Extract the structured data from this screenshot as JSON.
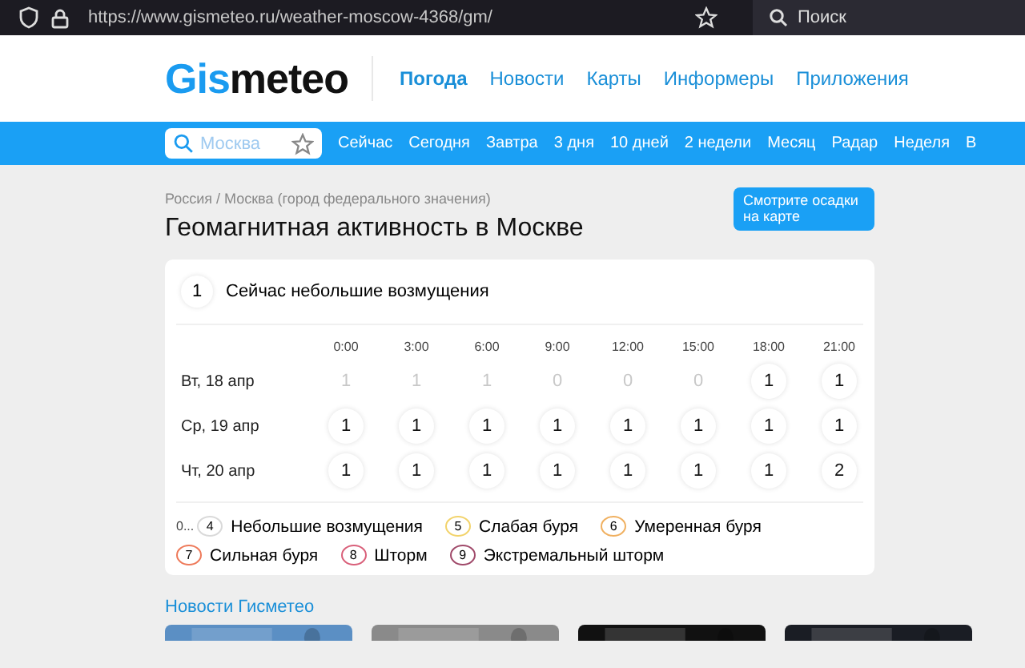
{
  "browser": {
    "url": "https://www.gismeteo.ru/weather-moscow-4368/gm/",
    "search_placeholder": "Поиск"
  },
  "logo": {
    "accent": "Gis",
    "rest": "meteo"
  },
  "main_menu": [
    {
      "label": "Погода",
      "selected": true
    },
    {
      "label": "Новости",
      "selected": false
    },
    {
      "label": "Карты",
      "selected": false
    },
    {
      "label": "Информеры",
      "selected": false
    },
    {
      "label": "Приложения",
      "selected": false
    }
  ],
  "city_search": {
    "placeholder": "Москва"
  },
  "nav": [
    "Сейчас",
    "Сегодня",
    "Завтра",
    "3 дня",
    "10 дней",
    "2 недели",
    "Месяц",
    "Радар",
    "Неделя",
    "В"
  ],
  "breadcrumb": "Россия / Москва (город федерального значения)",
  "title": "Геомагнитная активность в Москве",
  "map_button": "Смотрите осадки на карте",
  "current": {
    "value": "1",
    "text": "Сейчас небольшие возмущения"
  },
  "times": [
    "0:00",
    "3:00",
    "6:00",
    "9:00",
    "12:00",
    "15:00",
    "18:00",
    "21:00"
  ],
  "days": [
    {
      "label": "Вт, 18 апр",
      "cells": [
        {
          "value": "1",
          "past": true
        },
        {
          "value": "1",
          "past": true
        },
        {
          "value": "1",
          "past": true
        },
        {
          "value": "0",
          "past": true
        },
        {
          "value": "0",
          "past": true
        },
        {
          "value": "0",
          "past": true
        },
        {
          "value": "1",
          "past": false
        },
        {
          "value": "1",
          "past": false
        }
      ]
    },
    {
      "label": "Ср, 19 апр",
      "cells": [
        {
          "value": "1",
          "past": false
        },
        {
          "value": "1",
          "past": false
        },
        {
          "value": "1",
          "past": false
        },
        {
          "value": "1",
          "past": false
        },
        {
          "value": "1",
          "past": false
        },
        {
          "value": "1",
          "past": false
        },
        {
          "value": "1",
          "past": false
        },
        {
          "value": "1",
          "past": false
        }
      ]
    },
    {
      "label": "Чт, 20 апр",
      "cells": [
        {
          "value": "1",
          "past": false
        },
        {
          "value": "1",
          "past": false
        },
        {
          "value": "1",
          "past": false
        },
        {
          "value": "1",
          "past": false
        },
        {
          "value": "1",
          "past": false
        },
        {
          "value": "1",
          "past": false
        },
        {
          "value": "1",
          "past": false
        },
        {
          "value": "2",
          "past": false
        }
      ]
    }
  ],
  "legend": [
    {
      "prefix": "0...",
      "value": "4",
      "label": "Небольшие возмущения",
      "color": "#d9d9d9"
    },
    {
      "value": "5",
      "label": "Слабая буря",
      "color": "#f2d36b"
    },
    {
      "value": "6",
      "label": "Умеренная буря",
      "color": "#f0b060"
    },
    {
      "value": "7",
      "label": "Сильная буря",
      "color": "#ee7a5a"
    },
    {
      "value": "8",
      "label": "Шторм",
      "color": "#d9607a"
    },
    {
      "value": "9",
      "label": "Экстремальный шторм",
      "color": "#a04a6a"
    }
  ],
  "news_title": "Новости Гисметео"
}
